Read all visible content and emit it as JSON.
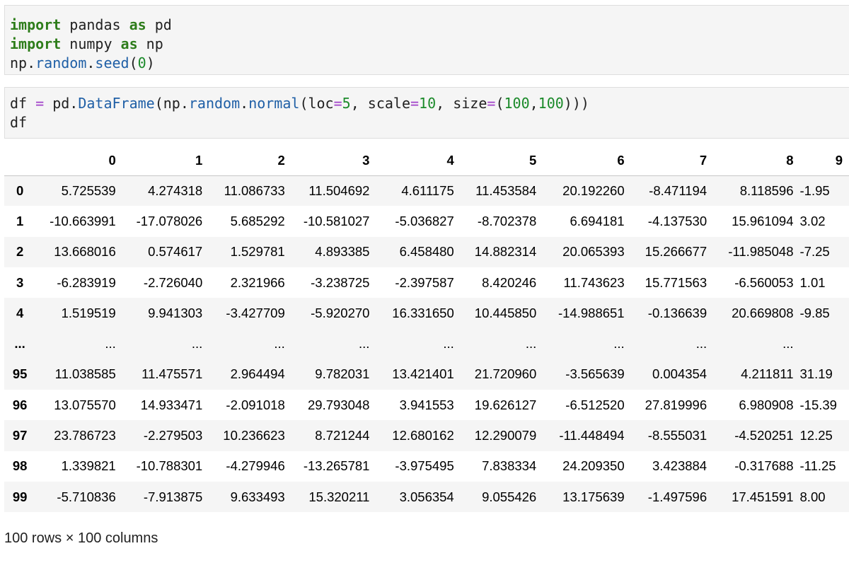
{
  "cell1": {
    "lines": [
      [
        {
          "t": "import",
          "c": "kw"
        },
        {
          "t": " pandas ",
          "c": "plain"
        },
        {
          "t": "as",
          "c": "kw"
        },
        {
          "t": " pd",
          "c": "plain"
        }
      ],
      [
        {
          "t": "import",
          "c": "kw"
        },
        {
          "t": " numpy ",
          "c": "plain"
        },
        {
          "t": "as",
          "c": "kw"
        },
        {
          "t": " np",
          "c": "plain"
        }
      ],
      [
        {
          "t": "np.",
          "c": "plain"
        },
        {
          "t": "random",
          "c": "attr"
        },
        {
          "t": ".",
          "c": "plain"
        },
        {
          "t": "seed",
          "c": "attr"
        },
        {
          "t": "(",
          "c": "plain"
        },
        {
          "t": "0",
          "c": "num"
        },
        {
          "t": ")",
          "c": "plain"
        }
      ]
    ]
  },
  "cell2": {
    "lines": [
      [
        {
          "t": "df ",
          "c": "plain"
        },
        {
          "t": "=",
          "c": "op"
        },
        {
          "t": " pd.",
          "c": "plain"
        },
        {
          "t": "DataFrame",
          "c": "attr"
        },
        {
          "t": "(np.",
          "c": "plain"
        },
        {
          "t": "random",
          "c": "attr"
        },
        {
          "t": ".",
          "c": "plain"
        },
        {
          "t": "normal",
          "c": "attr"
        },
        {
          "t": "(loc",
          "c": "plain"
        },
        {
          "t": "=",
          "c": "op"
        },
        {
          "t": "5",
          "c": "num"
        },
        {
          "t": ", scale",
          "c": "plain"
        },
        {
          "t": "=",
          "c": "op"
        },
        {
          "t": "10",
          "c": "num"
        },
        {
          "t": ", size",
          "c": "plain"
        },
        {
          "t": "=",
          "c": "op"
        },
        {
          "t": "(",
          "c": "plain"
        },
        {
          "t": "100",
          "c": "num"
        },
        {
          "t": ",",
          "c": "plain"
        },
        {
          "t": "100",
          "c": "num"
        },
        {
          "t": ")))",
          "c": "plain"
        }
      ],
      [
        {
          "t": "df",
          "c": "plain"
        }
      ]
    ]
  },
  "table": {
    "columns": [
      "0",
      "1",
      "2",
      "3",
      "4",
      "5",
      "6",
      "7",
      "8",
      "9"
    ],
    "rows": [
      {
        "index": "0",
        "cells": [
          "5.725539",
          "4.274318",
          "11.086733",
          "11.504692",
          "4.611175",
          "11.453584",
          "20.192260",
          "-8.471194",
          "8.118596",
          "-1.95"
        ]
      },
      {
        "index": "1",
        "cells": [
          "-10.663991",
          "-17.078026",
          "5.685292",
          "-10.581027",
          "-5.036827",
          "-8.702378",
          "6.694181",
          "-4.137530",
          "15.961094",
          "3.02"
        ]
      },
      {
        "index": "2",
        "cells": [
          "13.668016",
          "0.574617",
          "1.529781",
          "4.893385",
          "6.458480",
          "14.882314",
          "20.065393",
          "15.266677",
          "-11.985048",
          "-7.25"
        ]
      },
      {
        "index": "3",
        "cells": [
          "-6.283919",
          "-2.726040",
          "2.321966",
          "-3.238725",
          "-2.397587",
          "8.420246",
          "11.743623",
          "15.771563",
          "-6.560053",
          "1.01"
        ]
      },
      {
        "index": "4",
        "cells": [
          "1.519519",
          "9.941303",
          "-3.427709",
          "-5.920270",
          "16.331650",
          "10.445850",
          "-14.988651",
          "-0.136639",
          "20.669808",
          "-9.85"
        ]
      },
      {
        "index": "...",
        "cells": [
          "...",
          "...",
          "...",
          "...",
          "...",
          "...",
          "...",
          "...",
          "...",
          ""
        ],
        "ellipsis": true
      },
      {
        "index": "95",
        "cells": [
          "11.038585",
          "11.475571",
          "2.964494",
          "9.782031",
          "13.421401",
          "21.720960",
          "-3.565639",
          "0.004354",
          "4.211811",
          "31.19"
        ]
      },
      {
        "index": "96",
        "cells": [
          "13.075570",
          "14.933471",
          "-2.091018",
          "29.793048",
          "3.941553",
          "19.626127",
          "-6.512520",
          "27.819996",
          "6.980908",
          "-15.39"
        ]
      },
      {
        "index": "97",
        "cells": [
          "23.786723",
          "-2.279503",
          "10.236623",
          "8.721244",
          "12.680162",
          "12.290079",
          "-11.448494",
          "-8.555031",
          "-4.520251",
          "12.25"
        ]
      },
      {
        "index": "98",
        "cells": [
          "1.339821",
          "-10.788301",
          "-4.279946",
          "-13.265781",
          "-3.975495",
          "7.838334",
          "24.209350",
          "3.423884",
          "-0.317688",
          "-11.25"
        ]
      },
      {
        "index": "99",
        "cells": [
          "-5.710836",
          "-7.913875",
          "9.633493",
          "15.320211",
          "3.056354",
          "9.055426",
          "13.175639",
          "-1.497596",
          "17.451591",
          "8.00"
        ]
      }
    ]
  },
  "footer": "100 rows × 100 columns"
}
